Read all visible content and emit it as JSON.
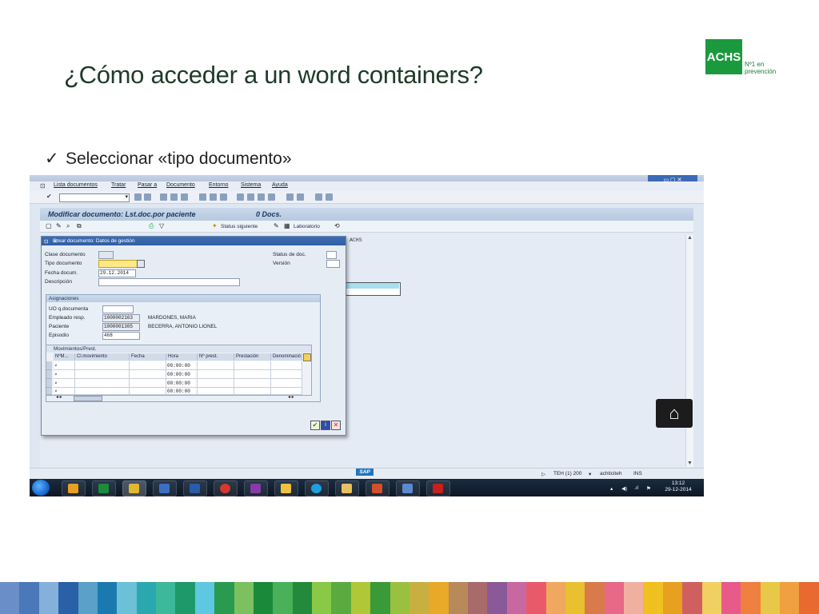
{
  "slide": {
    "title": "¿Cómo acceder a un word containers?",
    "bullet": "Seleccionar «tipo documento»",
    "logo_main": "ACHS",
    "logo_sub1": "Nº1 en",
    "logo_sub2": "prevención"
  },
  "sap": {
    "menu": [
      "Lista documentos",
      "Tratar",
      "Pasar a",
      "Documento",
      "Entorno",
      "Sistema",
      "Ayuda"
    ],
    "screen_title": "Modificar documento: Lst.doc.por paciente",
    "docs_count": "0 Docs.",
    "app_toolbar": {
      "status_siguiente": "Status siguiente",
      "laboratorio": "Laboratorio"
    },
    "work_text": "ACHS",
    "dialog": {
      "title": "Crear documento: Datos de gestión",
      "clase_documento_label": "Clase documento",
      "tipo_documento_label": "Tipo documento",
      "fecha_docum_label": "Fecha docum.",
      "fecha_docum_value": "29.12.2014",
      "descripcion_label": "Descripción",
      "status_doc_label": "Status de doc.",
      "version_label": "Versión",
      "asignaciones_label": "Asignaciones",
      "uo_label": "UO q.documenta",
      "empleado_label": "Empleado resp.",
      "empleado_id": "1000002163",
      "empleado_name": "MARDONES, MARIA",
      "paciente_label": "Paciente",
      "paciente_id": "1000001305",
      "paciente_name": "BECERRA, ANTONIO LIONEL",
      "episodio_label": "Episodio",
      "episodio_value": "468",
      "movimientos_label": "Movimientos/Prest.",
      "columns": [
        "NºM...",
        "Cl.movimiento",
        "Fecha",
        "Hora",
        "Nº prest.",
        "Prestación",
        "Denominació"
      ],
      "rows": [
        {
          "hora": "00:00:00"
        },
        {
          "hora": "00:00:00"
        },
        {
          "hora": "00:00:00"
        },
        {
          "hora": "00:00:00"
        }
      ]
    },
    "status_bar": {
      "system": "TEH (1) 200",
      "user": "achticiteh",
      "mode": "INS"
    },
    "taskbar": {
      "time": "13:12",
      "date": "29-12-2014"
    }
  },
  "colors": {
    "brand_green": "#1a9a3c",
    "sap_blue": "#2f5ea4",
    "highlight": "#a5dff0"
  },
  "icons": [
    "check-icon",
    "home-icon",
    "close-icon",
    "search-icon",
    "start-icon"
  ]
}
